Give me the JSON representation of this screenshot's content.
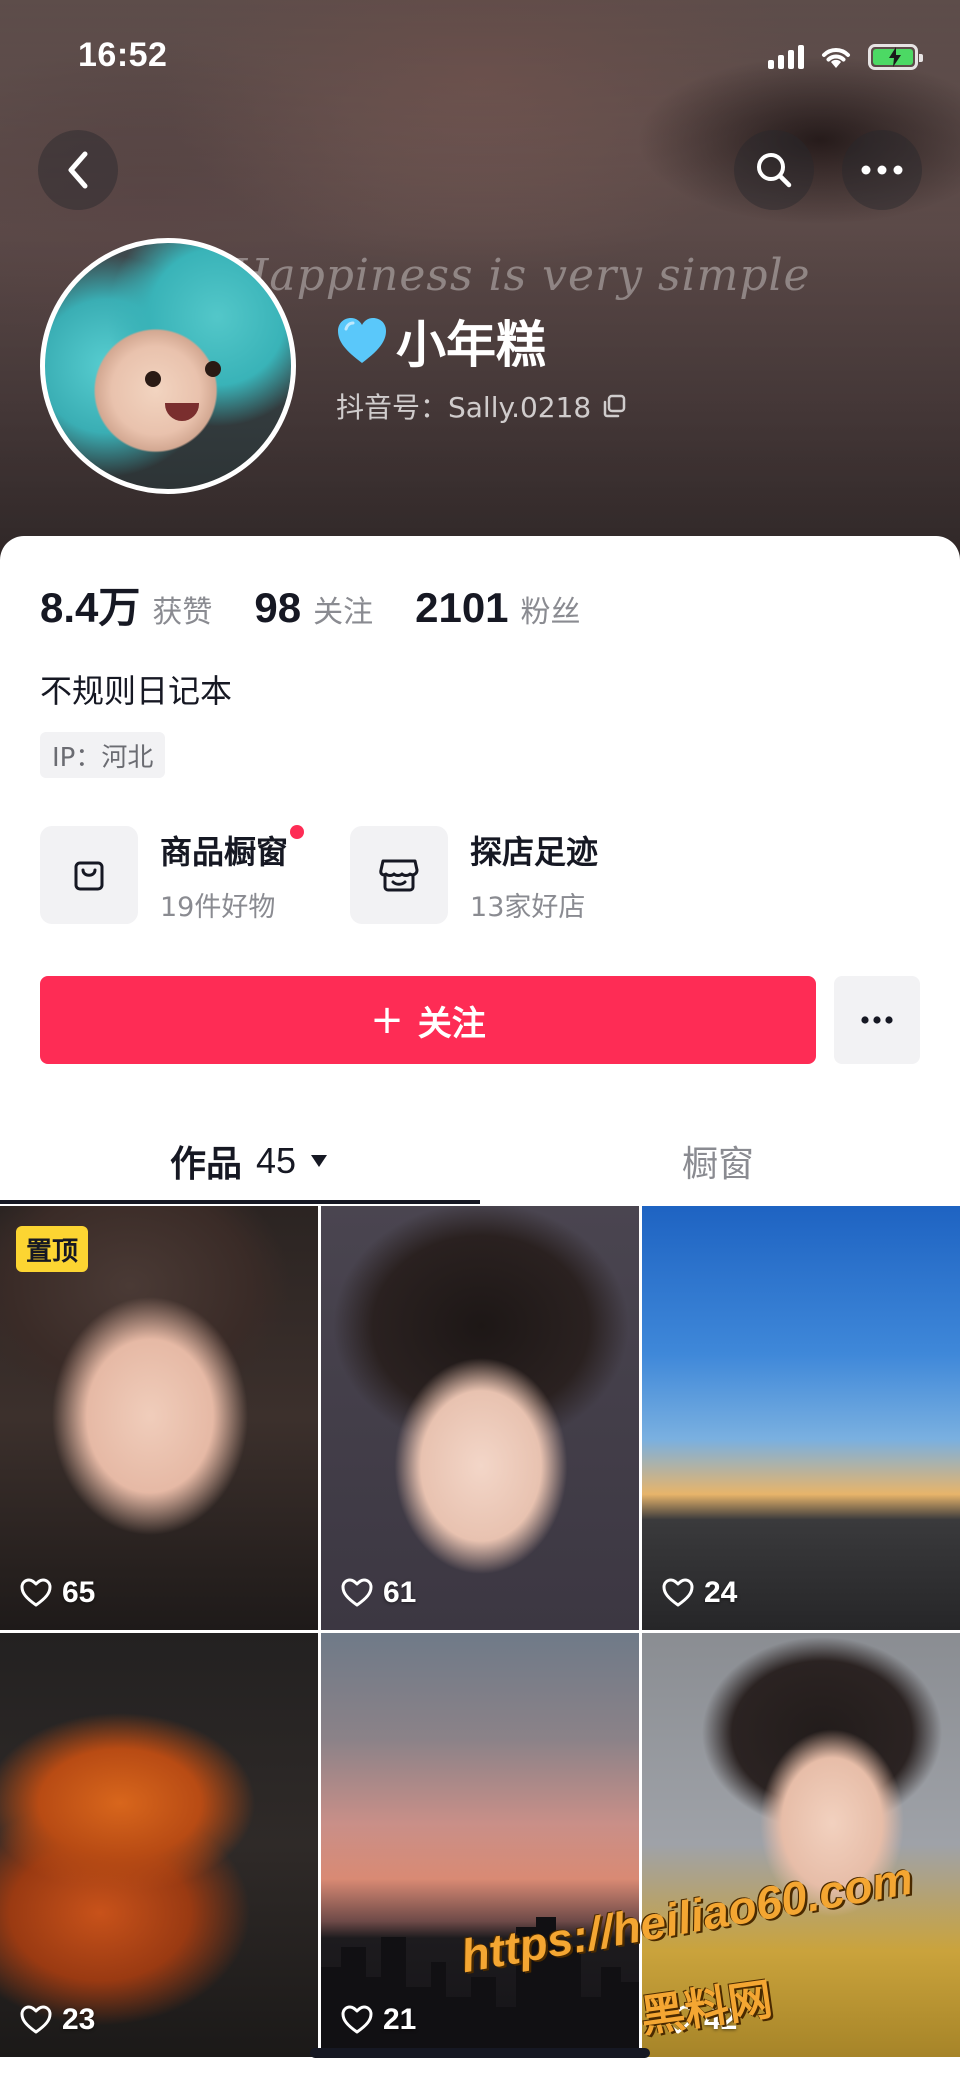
{
  "status_bar": {
    "time": "16:52"
  },
  "header": {
    "cover_script_text": "Happiness is very simple",
    "nickname": "小年糕",
    "douyin_id": "抖音号：Sally.0218"
  },
  "stats": [
    {
      "value": "8.4万",
      "label": "获赞"
    },
    {
      "value": "98",
      "label": "关注"
    },
    {
      "value": "2101",
      "label": "粉丝"
    }
  ],
  "bio": "不规则日记本",
  "ip_location": "IP：河北",
  "shop_entries": [
    {
      "title": "商品橱窗",
      "subtitle": "19件好物",
      "has_red_dot": true,
      "icon": "shopping-bag-icon"
    },
    {
      "title": "探店足迹",
      "subtitle": "13家好店",
      "has_red_dot": false,
      "icon": "store-icon"
    }
  ],
  "follow_button": {
    "plus": "+",
    "label": "关注"
  },
  "tabs": {
    "works_label": "作品",
    "works_count": "45",
    "shop_label": "橱窗"
  },
  "videos": [
    {
      "likes": "65",
      "pinned_label": "置顶"
    },
    {
      "likes": "61"
    },
    {
      "likes": "24"
    },
    {
      "likes": "23"
    },
    {
      "likes": "21"
    },
    {
      "likes": "42"
    }
  ],
  "watermark": {
    "url": "https://heiliao60.com",
    "text": "黑料网"
  },
  "colors": {
    "accent_red": "#fe2c55",
    "pin_yellow": "#fcd532",
    "heart_cyan": "#5ac8fa"
  }
}
